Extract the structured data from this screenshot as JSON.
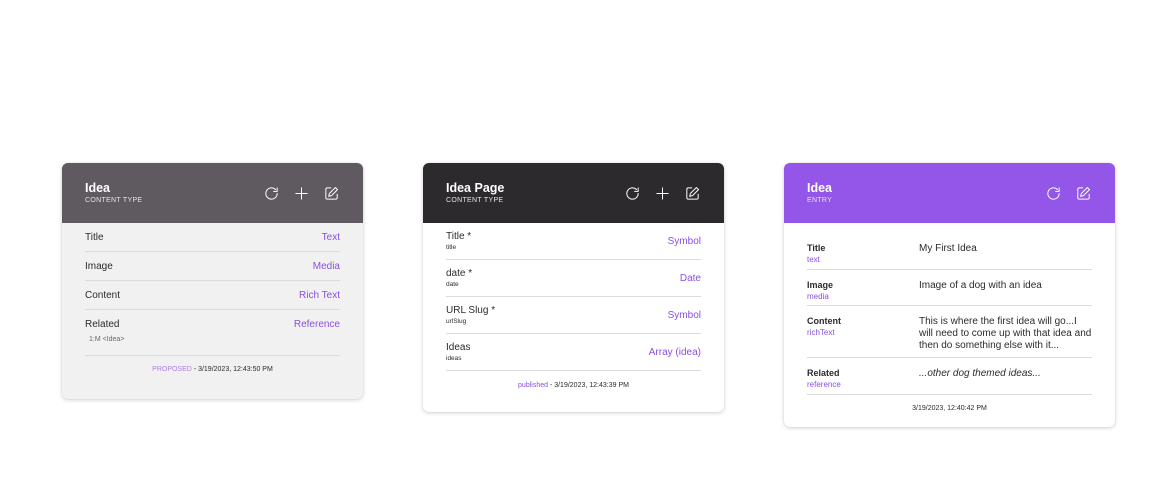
{
  "cards": [
    {
      "title": "Idea",
      "subtitle": "CONTENT TYPE",
      "fields": [
        {
          "name": "Title",
          "type": "Text"
        },
        {
          "name": "Image",
          "type": "Media"
        },
        {
          "name": "Content",
          "type": "Rich Text"
        },
        {
          "name": "Related",
          "type": "Reference",
          "relation": "1:M <Idea>"
        }
      ],
      "footer": {
        "status": "PROPOSED",
        "date": " - 3/19/2023, 12:43:50 PM"
      }
    },
    {
      "title": "Idea Page",
      "subtitle": "CONTENT TYPE",
      "fields": [
        {
          "name": "Title *",
          "id": "title",
          "type": "Symbol"
        },
        {
          "name": "date *",
          "id": "date",
          "type": "Date"
        },
        {
          "name": "URL Slug *",
          "id": "urlSlug",
          "type": "Symbol"
        },
        {
          "name": "Ideas",
          "id": "ideas",
          "type": "Array (idea)"
        }
      ],
      "footer": {
        "status": "published",
        "date": " - 3/19/2023, 12:43:39 PM"
      }
    },
    {
      "title": "Idea",
      "subtitle": "ENTRY",
      "fields": [
        {
          "name": "Title",
          "type": "text",
          "value": "My First Idea"
        },
        {
          "name": "Image",
          "type": "media",
          "value": "Image of a dog with an idea"
        },
        {
          "name": "Content",
          "type": "richText",
          "value": "This is where the first idea will go...I will need to come up with that idea and then do something else with it..."
        },
        {
          "name": "Related",
          "type": "reference",
          "value": "...other dog themed ideas..."
        }
      ],
      "footer": {
        "date": "3/19/2023, 12:40:42 PM"
      }
    }
  ],
  "icons": {
    "refresh": "refresh-icon",
    "add": "plus-icon",
    "edit": "edit-icon"
  },
  "colors": {
    "accent": "#8a4fe2",
    "card1_header": "#5f5a60",
    "card2_header": "#2d2a2e",
    "card3_header": "#9356e8"
  }
}
